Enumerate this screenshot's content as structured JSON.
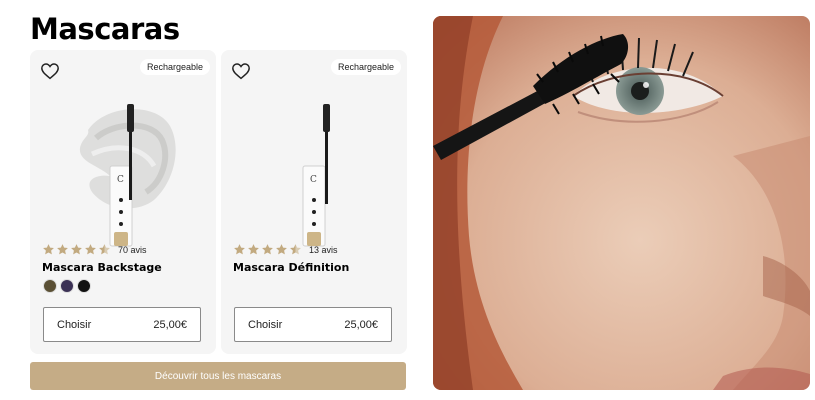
{
  "section": {
    "title": "Mascaras"
  },
  "products": [
    {
      "badge": "Rechargeable",
      "rating_stars": 4.5,
      "reviews": "70 avis",
      "name": "Mascara Backstage",
      "swatches": [
        "#5b5035",
        "#3b3155",
        "#111111"
      ],
      "choose_label": "Choisir",
      "price": "25,00€"
    },
    {
      "badge": "Rechargeable",
      "rating_stars": 4.5,
      "reviews": "13 avis",
      "name": "Mascara Définition",
      "swatches": [],
      "choose_label": "Choisir",
      "price": "25,00€"
    }
  ],
  "cta": {
    "label": "Découvrir tous les mascaras"
  },
  "colors": {
    "accent": "#c5ac86",
    "star": "#c2aa80",
    "card_bg": "#f5f5f5"
  },
  "icons": {
    "favorite": "heart-outline-icon",
    "rating": "star-icon"
  }
}
